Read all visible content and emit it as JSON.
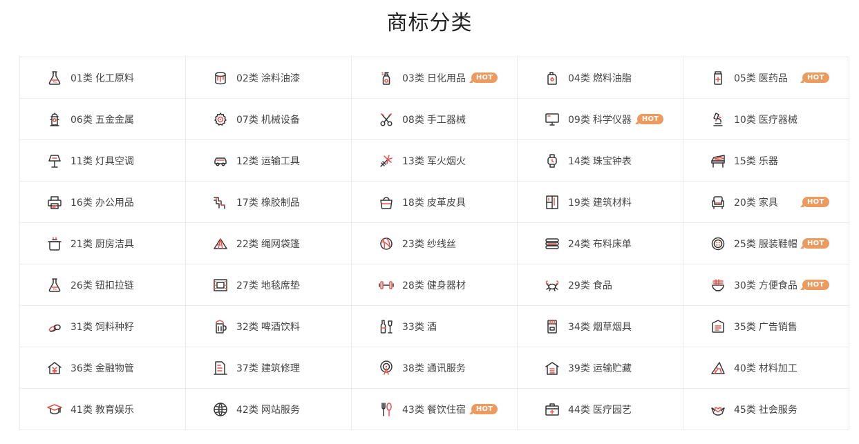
{
  "page": {
    "title": "商标分类",
    "hot_label": "HOT"
  },
  "colors": {
    "icon_dark": "#333333",
    "icon_accent": "#e8514a",
    "hot_badge": "#ec9a5e",
    "border": "#ebebeb"
  },
  "categories": [
    {
      "num": "01类",
      "name": "化工原料",
      "icon": "flask-icon",
      "hot": false
    },
    {
      "num": "02类",
      "name": "涂料油漆",
      "icon": "paint-bucket-icon",
      "hot": false
    },
    {
      "num": "03类",
      "name": "日化用品",
      "icon": "spray-bottle-icon",
      "hot": true
    },
    {
      "num": "04类",
      "name": "燃料油脂",
      "icon": "oil-can-icon",
      "hot": false
    },
    {
      "num": "05类",
      "name": "医药品",
      "icon": "medicine-bottle-icon",
      "hot": true
    },
    {
      "num": "06类",
      "name": "五金金属",
      "icon": "fire-hydrant-icon",
      "hot": false
    },
    {
      "num": "07类",
      "name": "机械设备",
      "icon": "gear-icon",
      "hot": false
    },
    {
      "num": "08类",
      "name": "手工器械",
      "icon": "scissors-icon",
      "hot": false
    },
    {
      "num": "09类",
      "name": "科学仪器",
      "icon": "monitor-icon",
      "hot": true
    },
    {
      "num": "10类",
      "name": "医疗器械",
      "icon": "microscope-icon",
      "hot": false
    },
    {
      "num": "11类",
      "name": "灯具空调",
      "icon": "lamp-icon",
      "hot": false
    },
    {
      "num": "12类",
      "name": "运输工具",
      "icon": "car-icon",
      "hot": false
    },
    {
      "num": "13类",
      "name": "军火烟火",
      "icon": "firework-icon",
      "hot": false
    },
    {
      "num": "14类",
      "name": "珠宝钟表",
      "icon": "watch-icon",
      "hot": false
    },
    {
      "num": "15类",
      "name": "乐器",
      "icon": "piano-icon",
      "hot": false
    },
    {
      "num": "16类",
      "name": "办公用品",
      "icon": "printer-icon",
      "hot": false
    },
    {
      "num": "17类",
      "name": "橡胶制品",
      "icon": "pipe-icon",
      "hot": false
    },
    {
      "num": "18类",
      "name": "皮革皮具",
      "icon": "handbag-icon",
      "hot": false
    },
    {
      "num": "19类",
      "name": "建筑材料",
      "icon": "building-panel-icon",
      "hot": false
    },
    {
      "num": "20类",
      "name": "家具",
      "icon": "armchair-icon",
      "hot": true
    },
    {
      "num": "21类",
      "name": "厨房洁具",
      "icon": "cooking-pot-icon",
      "hot": false
    },
    {
      "num": "22类",
      "name": "绳网袋篷",
      "icon": "tent-icon",
      "hot": false
    },
    {
      "num": "23类",
      "name": "纱线丝",
      "icon": "yarn-ball-icon",
      "hot": false
    },
    {
      "num": "24类",
      "name": "布料床单",
      "icon": "fabric-stack-icon",
      "hot": false
    },
    {
      "num": "25类",
      "name": "服装鞋帽",
      "icon": "button-icon",
      "hot": true
    },
    {
      "num": "26类",
      "name": "钮扣拉链",
      "icon": "flask-icon",
      "hot": false
    },
    {
      "num": "27类",
      "name": "地毯席垫",
      "icon": "carpet-icon",
      "hot": false
    },
    {
      "num": "28类",
      "name": "健身器材",
      "icon": "dumbbell-icon",
      "hot": false
    },
    {
      "num": "29类",
      "name": "食品",
      "icon": "crab-icon",
      "hot": false
    },
    {
      "num": "30类",
      "name": "方便食品",
      "icon": "noodle-bowl-icon",
      "hot": true
    },
    {
      "num": "31类",
      "name": "饲料种籽",
      "icon": "seed-icon",
      "hot": false
    },
    {
      "num": "32类",
      "name": "啤酒饮料",
      "icon": "beer-mug-icon",
      "hot": false
    },
    {
      "num": "33类",
      "name": "酒",
      "icon": "wine-bottle-icon",
      "hot": false
    },
    {
      "num": "34类",
      "name": "烟草烟具",
      "icon": "cigarette-box-icon",
      "hot": false
    },
    {
      "num": "35类",
      "name": "广告销售",
      "icon": "sign-board-icon",
      "hot": false
    },
    {
      "num": "36类",
      "name": "金融物管",
      "icon": "house-yuan-icon",
      "hot": false
    },
    {
      "num": "37类",
      "name": "建筑修理",
      "icon": "building-icon",
      "hot": false
    },
    {
      "num": "38类",
      "name": "通讯服务",
      "icon": "signal-tower-icon",
      "hot": false
    },
    {
      "num": "39类",
      "name": "运输贮藏",
      "icon": "warehouse-icon",
      "hot": false
    },
    {
      "num": "40类",
      "name": "材料加工",
      "icon": "triangle-ruler-icon",
      "hot": false
    },
    {
      "num": "41类",
      "name": "教育娱乐",
      "icon": "graduation-cap-icon",
      "hot": false
    },
    {
      "num": "42类",
      "name": "网站服务",
      "icon": "globe-icon",
      "hot": false
    },
    {
      "num": "43类",
      "name": "餐饮住宿",
      "icon": "fork-spoon-icon",
      "hot": true
    },
    {
      "num": "44类",
      "name": "医疗园艺",
      "icon": "medical-kit-icon",
      "hot": false
    },
    {
      "num": "45类",
      "name": "社会服务",
      "icon": "hands-heart-icon",
      "hot": false
    }
  ]
}
